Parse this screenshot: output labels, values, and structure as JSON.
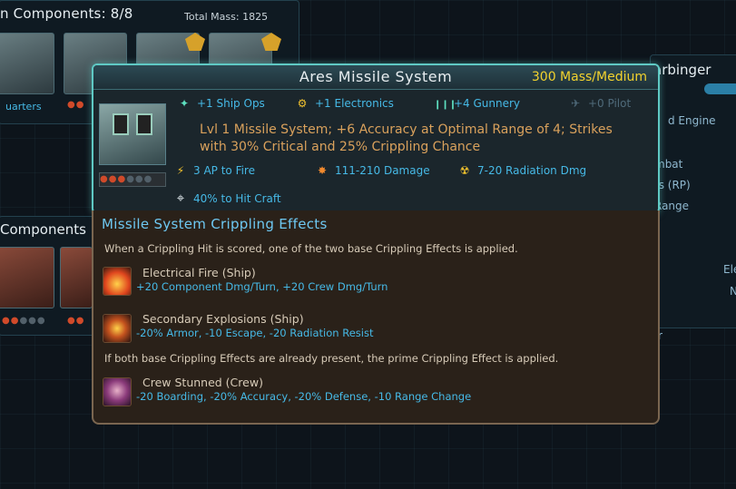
{
  "background": {
    "components_title": "n Components: 8/8",
    "total_mass_label": "Total Mass: 1825",
    "quarters_label": "uarters",
    "components_title_2": "Components",
    "right_panel_title": "arbinger",
    "right_labels": [
      "d Engine",
      "mbat",
      "ts (RP)",
      "Range",
      "Ele",
      "N",
      "r"
    ]
  },
  "tooltip": {
    "title": "Ares Missile System",
    "mass": "300 Mass/Medium",
    "stats_row1": [
      {
        "icon": "ship-ops-icon",
        "glyph": "✦",
        "label": "+1 Ship Ops"
      },
      {
        "icon": "electronics-icon",
        "glyph": "⚙",
        "label": "+1 Electronics"
      },
      {
        "icon": "gunnery-icon",
        "glyph": "❙❙❙",
        "label": "+4 Gunnery"
      },
      {
        "icon": "pilot-icon",
        "glyph": "✈",
        "label": "+0 Pilot"
      }
    ],
    "description": "Lvl 1 Missile System; +6 Accuracy at Optimal Range of 4; Strikes with 30% Critical and 25% Crippling Chance",
    "stats_row2": [
      {
        "icon": "action-points-icon",
        "glyph": "⚡",
        "label": "3 AP to Fire"
      },
      {
        "icon": "damage-icon",
        "glyph": "✸",
        "label": "111-210 Damage"
      },
      {
        "icon": "radiation-icon",
        "glyph": "☢",
        "label": "7-20 Radiation Dmg"
      }
    ],
    "hit_chance": {
      "icon": "crosshair-icon",
      "glyph": "⌖",
      "label": "40% to Hit Craft"
    },
    "crippling": {
      "title": "Missile System Crippling Effects",
      "intro": "When a Crippling Hit is scored, one of the two base Crippling Effects is applied.",
      "effects": [
        {
          "icon": "fire-icon",
          "glyph": "🔥",
          "name": "Electrical Fire (Ship)",
          "desc": "+20 Component Dmg/Turn, +20 Crew Dmg/Turn"
        },
        {
          "icon": "explosion-icon",
          "glyph": "✹",
          "name": "Secondary Explosions (Ship)",
          "desc": "-20% Armor, -10 Escape, -20 Radiation Resist"
        }
      ],
      "prime_note": "If both base Crippling Effects are already present, the prime Crippling Effect is applied.",
      "prime_effect": {
        "icon": "stunned-crew-icon",
        "glyph": "☻",
        "name": "Crew Stunned (Crew)",
        "desc": "-20 Boarding, -20% Accuracy, -20% Defense, -10 Range Change"
      }
    }
  },
  "colors": {
    "accent_cyan": "#5fc9c4",
    "mass_yellow": "#f2d22e",
    "stat_blue": "#46b9e6",
    "desc_orange": "#d9a15c"
  }
}
